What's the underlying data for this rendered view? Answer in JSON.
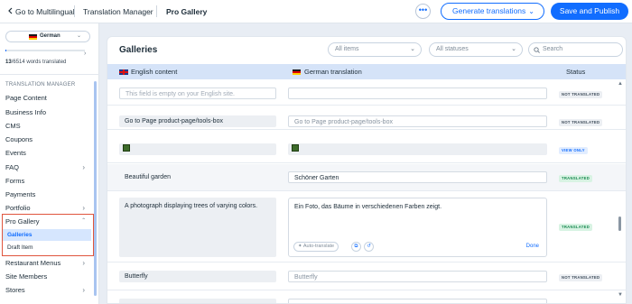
{
  "topbar": {
    "back_label": "Go to Multilingual",
    "section": "Translation Manager",
    "page": "Pro Gallery",
    "more_label": "•••",
    "generate_label": "Generate translations",
    "save_label": "Save and Publish"
  },
  "sidebar": {
    "language": "German",
    "words_done": "13",
    "words_total": "/6514 words translated",
    "words_progress": 0.002,
    "section_title": "TRANSLATION MANAGER",
    "items": [
      {
        "label": "Page Content"
      },
      {
        "label": "Business Info"
      },
      {
        "label": "CMS"
      },
      {
        "label": "Coupons"
      },
      {
        "label": "Events"
      },
      {
        "label": "FAQ"
      },
      {
        "label": "Forms"
      },
      {
        "label": "Payments"
      },
      {
        "label": "Portfolio"
      },
      {
        "label": "Pro Gallery"
      },
      {
        "label": "Restaurant Menus"
      },
      {
        "label": "Site Members"
      },
      {
        "label": "Stores"
      }
    ],
    "sub_items": [
      {
        "label": "Galleries",
        "active": true
      },
      {
        "label": "Draft Item",
        "active": false
      }
    ]
  },
  "main": {
    "title": "Galleries",
    "filter_items": "All items",
    "filter_statuses": "All statuses",
    "search_placeholder": "Search",
    "col_source": "English content",
    "col_target": "German translation",
    "col_status": "Status",
    "rows": [
      {
        "en": "This field is empty on your English site.",
        "de": "",
        "status": "NOT TRANSLATED"
      },
      {
        "en": "Go to Page product-page/tools-box",
        "de": "Go to Page product-page/tools-box",
        "status": "NOT TRANSLATED"
      },
      {
        "en": "",
        "de": "",
        "status": "VIEW ONLY"
      },
      {
        "en": "Beautiful garden",
        "de": "Schöner Garten",
        "status": "TRANSLATED"
      },
      {
        "en": "A photograph displaying trees of varying colors.",
        "de": "Ein Foto, das Bäume in verschiedenen Farben zeigt.",
        "status": "TRANSLATED"
      },
      {
        "en": "Butterfly",
        "de": "Butterfly",
        "status": "NOT TRANSLATED"
      }
    ],
    "auto_translate": "Auto-translate",
    "done_label": "Done"
  }
}
